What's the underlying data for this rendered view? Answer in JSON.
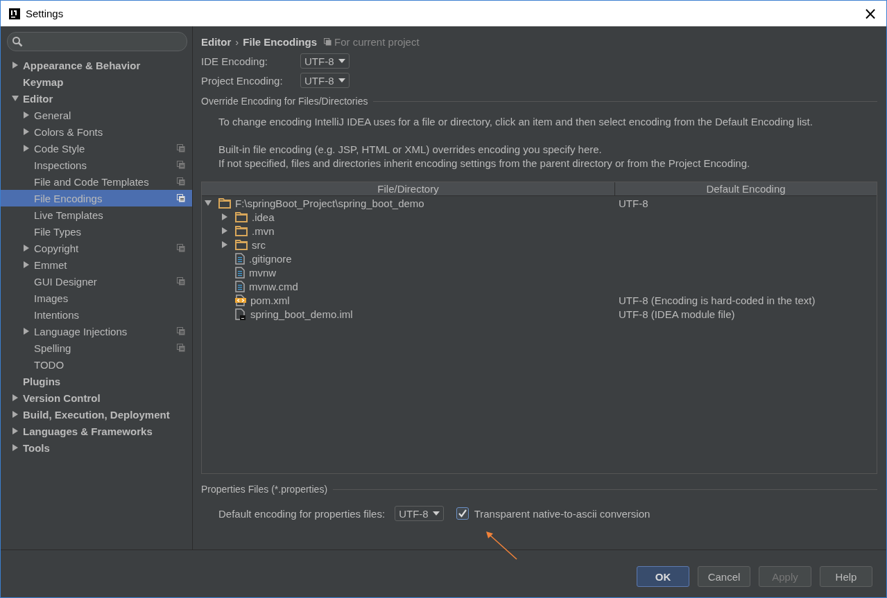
{
  "window": {
    "title": "Settings",
    "close": "×"
  },
  "sidebar": {
    "items": [
      {
        "label": "Appearance & Behavior",
        "expanded": false,
        "selected": false,
        "project_scope": false
      },
      {
        "label": "Keymap",
        "selected": false,
        "project_scope": false
      },
      {
        "label": "Editor",
        "expanded": true,
        "selected": false,
        "project_scope": false,
        "children": [
          {
            "label": "General",
            "expanded": false,
            "selected": false,
            "project_scope": false
          },
          {
            "label": "Colors & Fonts",
            "expanded": false,
            "selected": false,
            "project_scope": false
          },
          {
            "label": "Code Style",
            "expanded": false,
            "selected": false,
            "project_scope": true
          },
          {
            "label": "Inspections",
            "selected": false,
            "project_scope": true
          },
          {
            "label": "File and Code Templates",
            "selected": false,
            "project_scope": true
          },
          {
            "label": "File Encodings",
            "selected": true,
            "project_scope": true
          },
          {
            "label": "Live Templates",
            "selected": false,
            "project_scope": false
          },
          {
            "label": "File Types",
            "selected": false,
            "project_scope": false
          },
          {
            "label": "Copyright",
            "expanded": false,
            "selected": false,
            "project_scope": true
          },
          {
            "label": "Emmet",
            "expanded": false,
            "selected": false,
            "project_scope": false
          },
          {
            "label": "GUI Designer",
            "selected": false,
            "project_scope": true
          },
          {
            "label": "Images",
            "selected": false,
            "project_scope": false
          },
          {
            "label": "Intentions",
            "selected": false,
            "project_scope": false
          },
          {
            "label": "Language Injections",
            "expanded": false,
            "selected": false,
            "project_scope": true
          },
          {
            "label": "Spelling",
            "selected": false,
            "project_scope": true
          },
          {
            "label": "TODO",
            "selected": false,
            "project_scope": false
          }
        ]
      },
      {
        "label": "Plugins",
        "selected": false,
        "project_scope": false
      },
      {
        "label": "Version Control",
        "expanded": false,
        "selected": false,
        "project_scope": false
      },
      {
        "label": "Build, Execution, Deployment",
        "expanded": false,
        "selected": false,
        "project_scope": false
      },
      {
        "label": "Languages & Frameworks",
        "expanded": false,
        "selected": false,
        "project_scope": false
      },
      {
        "label": "Tools",
        "expanded": false,
        "selected": false,
        "project_scope": false
      }
    ]
  },
  "breadcrumb": {
    "parent": "Editor",
    "separator": "›",
    "current": "File Encodings",
    "scope": "For current project"
  },
  "encodings": [
    {
      "label": "IDE Encoding:",
      "value": "UTF-8"
    },
    {
      "label": "Project Encoding:",
      "value": "UTF-8"
    }
  ],
  "override": {
    "title": "Override Encoding for Files/Directories",
    "notes": [
      "To change encoding IntelliJ IDEA uses for a file or directory, click an item and then select encoding from the Default Encoding list.",
      "Built-in file encoding (e.g. JSP, HTML or XML) overrides encoding you specify here.",
      "If not specified, files and directories inherit encoding settings from the parent directory or from the Project Encoding."
    ],
    "table": {
      "columns": [
        "File/Directory",
        "Default Encoding"
      ],
      "rows": [
        {
          "name": "F:\\springBoot_Project\\spring_boot_demo",
          "kind": "folder",
          "expanded": true,
          "encoding": "UTF-8",
          "children": [
            {
              "name": ".idea",
              "kind": "folder",
              "expanded": false
            },
            {
              "name": ".mvn",
              "kind": "folder",
              "expanded": false
            },
            {
              "name": "src",
              "kind": "folder",
              "expanded": false
            },
            {
              "name": ".gitignore",
              "kind": "text"
            },
            {
              "name": "mvnw",
              "kind": "text"
            },
            {
              "name": "mvnw.cmd",
              "kind": "text"
            },
            {
              "name": "pom.xml",
              "kind": "xml",
              "encoding": "UTF-8 (Encoding is hard-coded in the text)"
            },
            {
              "name": "spring_boot_demo.iml",
              "kind": "module",
              "encoding": "UTF-8 (IDEA module file)"
            }
          ]
        }
      ]
    }
  },
  "properties": {
    "title": "Properties Files (*.properties)",
    "label": "Default encoding for properties files:",
    "value": "UTF-8",
    "checkbox": {
      "label": "Transparent native-to-ascii conversion",
      "checked": true
    }
  },
  "buttons": [
    {
      "label": "OK",
      "default": true,
      "disabled": false
    },
    {
      "label": "Cancel",
      "default": false,
      "disabled": false
    },
    {
      "label": "Apply",
      "default": false,
      "disabled": true
    },
    {
      "label": "Help",
      "default": false,
      "disabled": false
    }
  ]
}
